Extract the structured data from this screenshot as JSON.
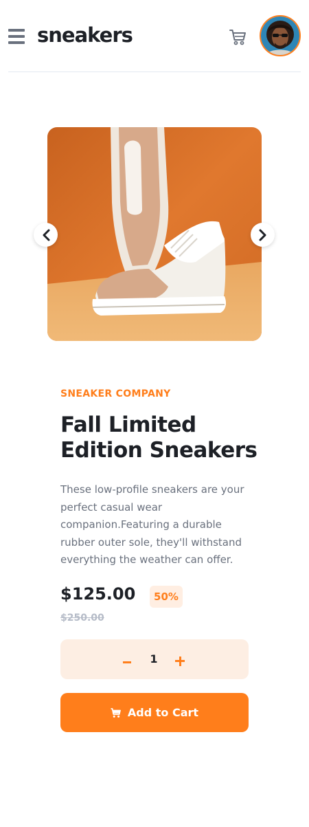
{
  "header": {
    "logo": "sneakers",
    "menu_icon": "hamburger-menu-icon",
    "cart_icon": "cart-icon",
    "avatar": "user-avatar"
  },
  "gallery": {
    "prev_icon": "chevron-left-icon",
    "next_icon": "chevron-right-icon",
    "image_subject": "white and tan sneakers on orange background"
  },
  "product": {
    "company": "SNEAKER COMPANY",
    "title": "Fall Limited Edition Sneakers",
    "description": "These low-profile sneakers are your perfect casual wear companion.Featuring a durable rubber outer sole, they'll withstand everything the weather can offer.",
    "price": "$125.00",
    "discount": "50%",
    "old_price": "$250.00"
  },
  "quantity": {
    "value": "1"
  },
  "cart_button": {
    "label": "Add to Cart",
    "icon": "cart-icon"
  },
  "colors": {
    "accent": "#ff7e1b",
    "accent_pale": "#ffeee2",
    "dark": "#1d2026",
    "grey_text": "#69707d"
  }
}
